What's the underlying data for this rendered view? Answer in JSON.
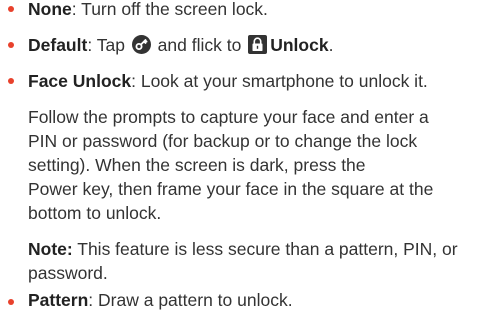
{
  "accent": "#e8412c",
  "items": [
    {
      "term": "None",
      "desc": ": Turn off the screen lock."
    },
    {
      "term": "Default",
      "desc_a": ": Tap ",
      "desc_b": " and flick to ",
      "unlock": "Unlock",
      "desc_c": ".",
      "icons": [
        "key-icon",
        "lock-icon"
      ]
    },
    {
      "term": "Face Unlock",
      "desc": ": Look at your smartphone to unlock it."
    },
    {
      "term": "Pattern",
      "desc": ": Draw a pattern to unlock."
    }
  ],
  "face_paragraph": [
    "Follow the prompts to capture your face and enter a",
    "PIN or password (for backup or to change the lock",
    "setting). When the screen is dark, press the",
    "Power key, then frame your face in the square at the",
    "bottom to unlock."
  ],
  "note": {
    "label": "Note:",
    "line1": " This feature is less secure than a pattern, PIN, or",
    "line2": "password."
  }
}
